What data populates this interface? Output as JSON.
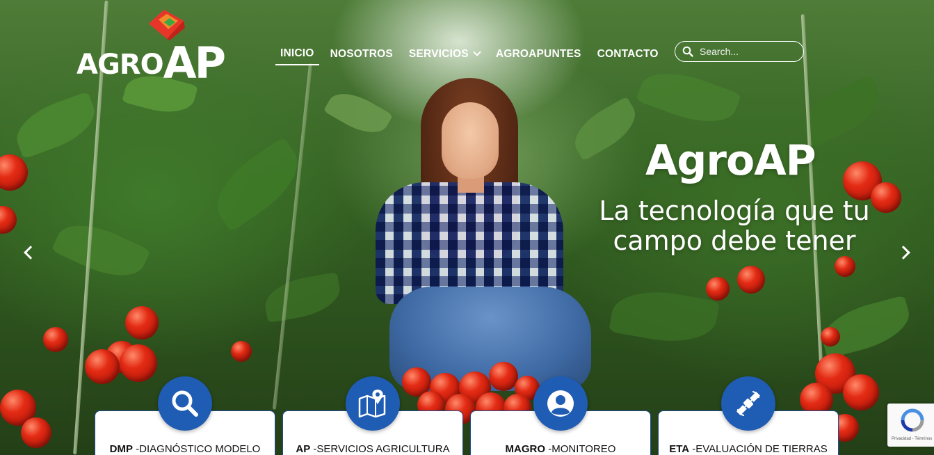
{
  "brand": {
    "logo_text_1": "AGRO",
    "logo_text_2": "AP"
  },
  "nav": {
    "items": [
      {
        "label": "INICIO",
        "active": true
      },
      {
        "label": "NOSOTROS"
      },
      {
        "label": "SERVICIOS",
        "has_dropdown": true
      },
      {
        "label": "AGROAPUNTES"
      },
      {
        "label": "CONTACTO"
      }
    ]
  },
  "search": {
    "placeholder": "Search..."
  },
  "slide": {
    "title": "AgroAP",
    "subtitle": "La tecnología que tu campo debe tener"
  },
  "services": [
    {
      "code": "DMP",
      "label": " -DIAGNÓSTICO MODELO",
      "icon": "magnifier-icon"
    },
    {
      "code": "AP",
      "label": " -SERVICIOS AGRICULTURA",
      "icon": "map-pin-icon"
    },
    {
      "code": "MAGRO",
      "label": " -MONITOREO",
      "icon": "user-icon"
    },
    {
      "code": "ETA",
      "label": " -EVALUACIÓN DE TIERRAS",
      "icon": "satellite-icon"
    }
  ],
  "recaptcha": {
    "text": "Privacidad - Términos"
  },
  "colors": {
    "accent": "#1f5cb3",
    "card_border": "#1c4e9a",
    "text_on_hero": "#ffffff"
  }
}
